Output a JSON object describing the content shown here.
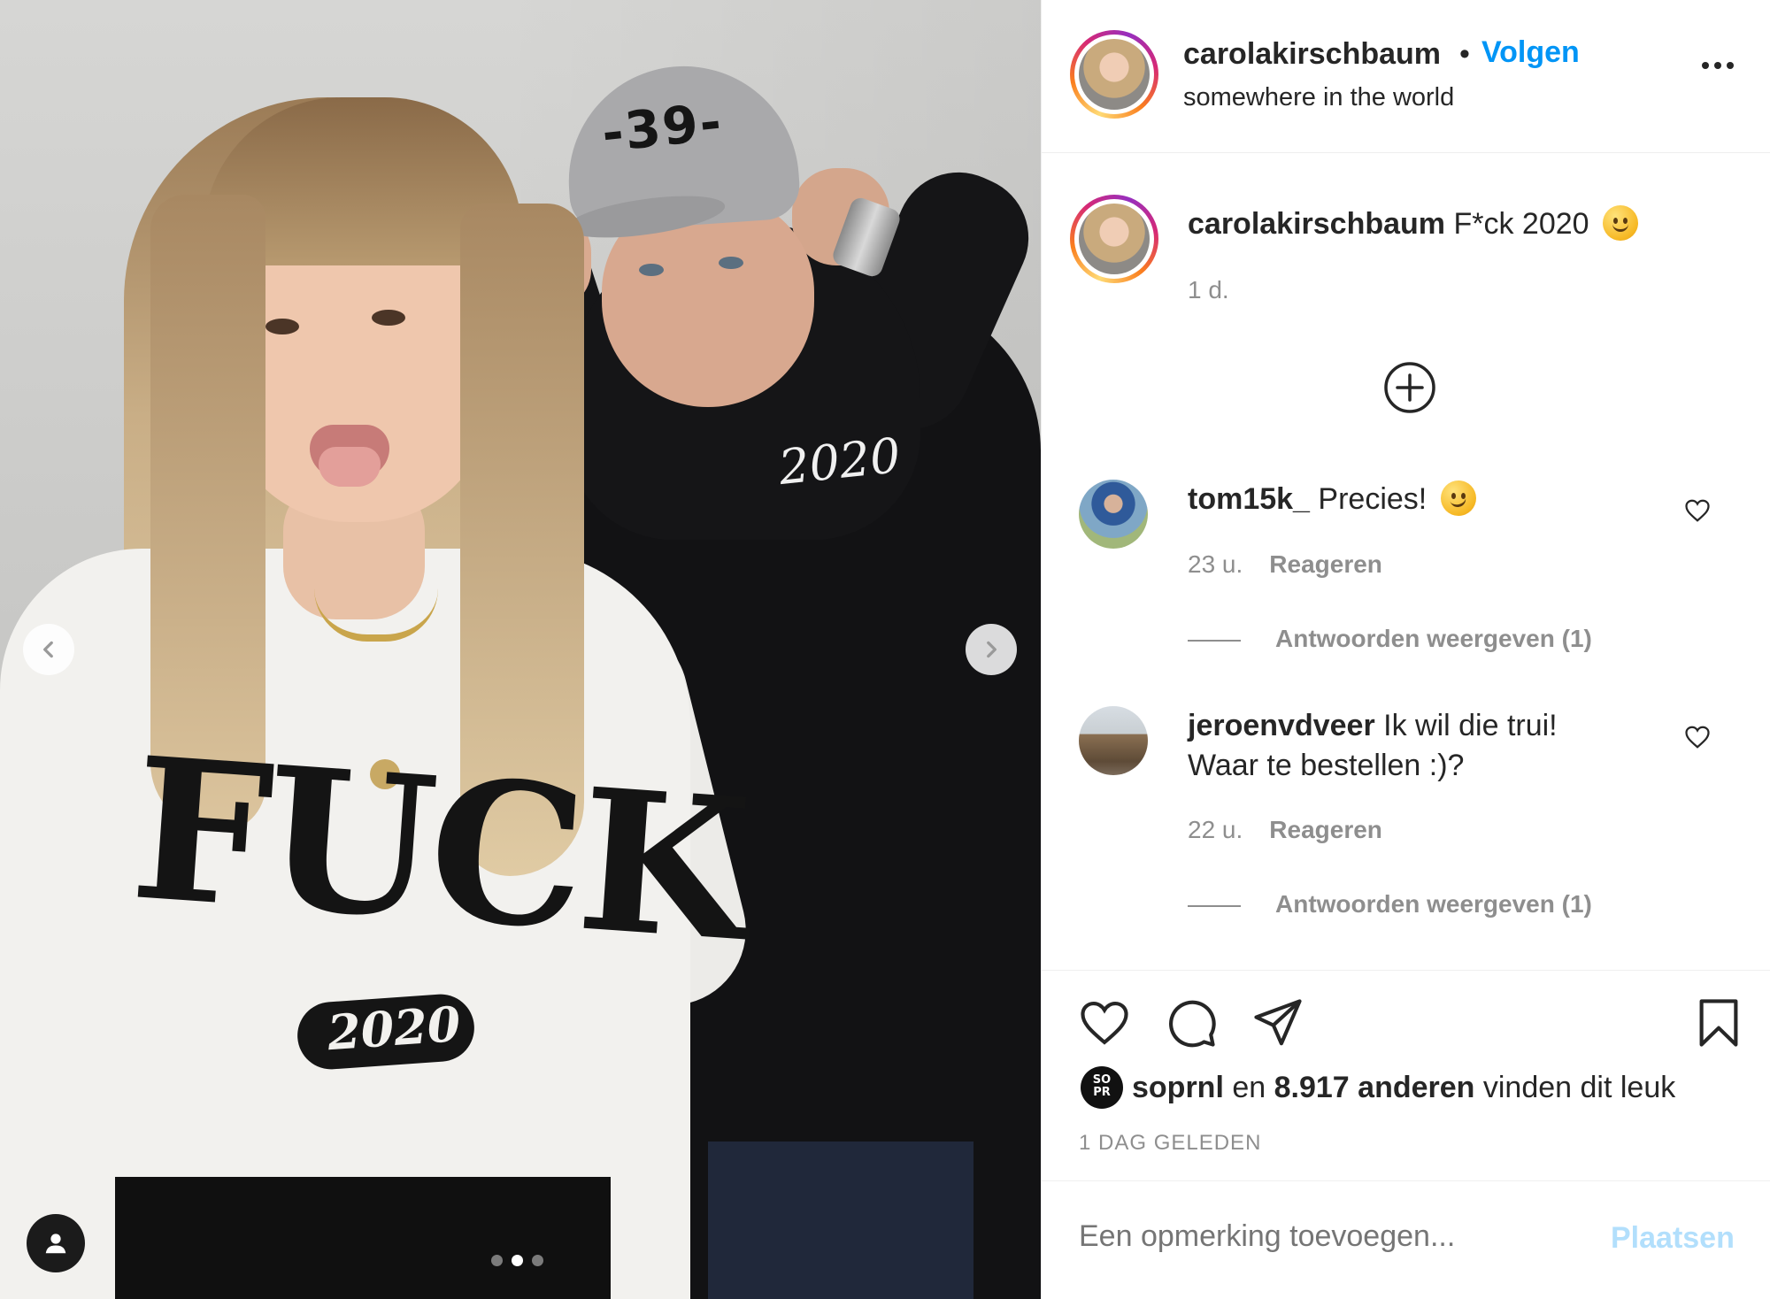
{
  "post": {
    "photo": {
      "carousel_dots": 3,
      "active_dot": 2,
      "prev_icon": "chevron-left-icon",
      "next_icon": "chevron-right-icon",
      "tag_icon": "user-tag-icon"
    },
    "header": {
      "username": "carolakirschbaum",
      "separator": "•",
      "follow_label": "Volgen",
      "location": "somewhere in the world",
      "more_icon": "more-horizontal-icon"
    },
    "caption": {
      "username": "carolakirschbaum",
      "text": "F*ck 2020",
      "emoji": "slightly-smiling-face",
      "time": "1 d."
    },
    "load_more_icon": "plus-circle-icon",
    "comments": [
      {
        "username": "tom15k_",
        "line1": "Precies!",
        "line2": "",
        "emoji": "smirking-face",
        "time": "23 u.",
        "reply_label": "Reageren",
        "view_replies": "Antwoorden weergeven (1)"
      },
      {
        "username": "jeroenvdveer",
        "line1": "Ik wil die trui!",
        "line2": "Waar te bestellen :)?",
        "time": "22 u.",
        "reply_label": "Reageren",
        "view_replies": "Antwoorden weergeven (1)"
      }
    ],
    "actions": {
      "like_icon": "heart-icon",
      "comment_icon": "comment-icon",
      "share_icon": "paper-plane-icon",
      "save_icon": "bookmark-icon"
    },
    "likes": {
      "liker_avatar_text_1": "SO",
      "liker_avatar_text_2": "PR",
      "liker": "soprnl",
      "middle": " en ",
      "count_text": "8.917 anderen",
      "suffix": " vinden dit leuk"
    },
    "posted_ago": "1 DAG GELEDEN",
    "comment_box": {
      "placeholder": "Een opmerking toevoegen...",
      "post_label": "Plaatsen"
    }
  },
  "colors": {
    "link_blue": "#0095f6",
    "post_disabled": "#b2dffc",
    "secondary_text": "#8e8e8e",
    "primary_text": "#262626"
  }
}
